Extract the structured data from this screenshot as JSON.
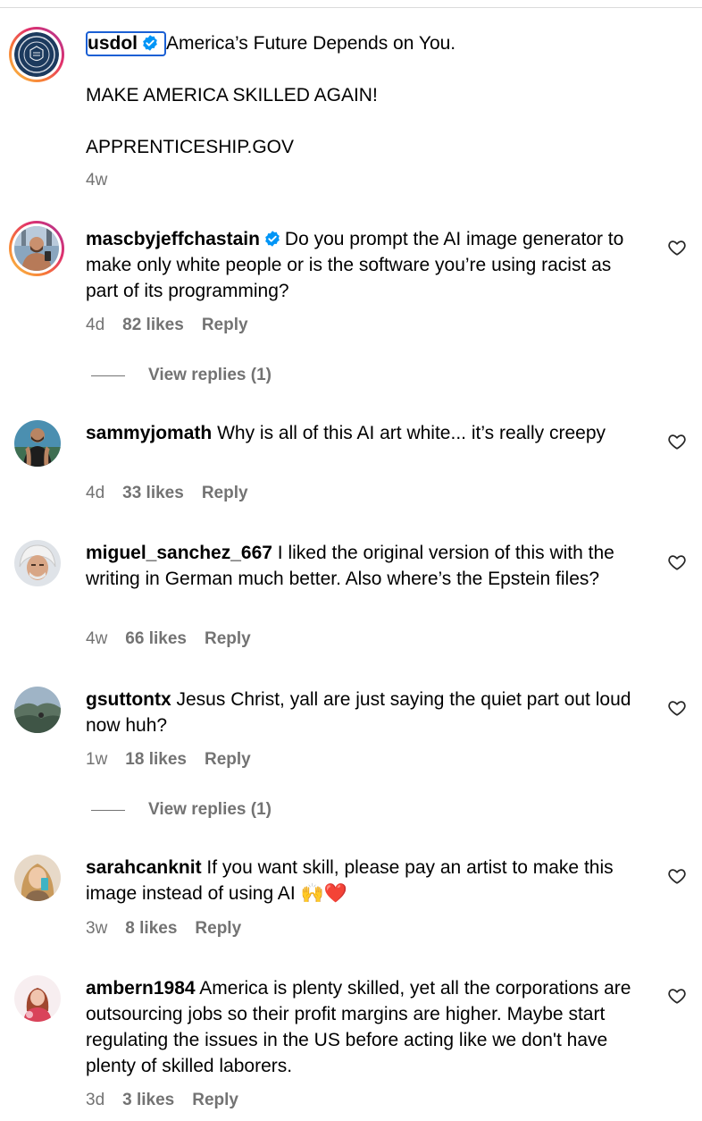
{
  "post": {
    "username": "usdol",
    "lines": [
      "America’s Future Depends on You.",
      "MAKE AMERICA SKILLED AGAIN!",
      "APPRENTICESHIP.GOV"
    ],
    "time": "4w"
  },
  "comments": [
    {
      "username": "mascbyjeffchastain",
      "verified": true,
      "text": "Do you prompt the AI image generator to make only white people or is the software you’re using racist as part of its programming?",
      "time": "4d",
      "likes": "82 likes",
      "reply": "Reply",
      "view_replies": "View replies (1)"
    },
    {
      "username": "sammyjomath",
      "text": "Why is all of this AI art white... it’s really creepy",
      "time": "4d",
      "likes": "33 likes",
      "reply": "Reply"
    },
    {
      "username": "miguel_sanchez_667",
      "text": "I liked the original version of this with the writing in German much better. Also where’s the Epstein files?",
      "time": "4w",
      "likes": "66 likes",
      "reply": "Reply"
    },
    {
      "username": "gsuttontx",
      "text": "Jesus Christ, yall are just saying the quiet part out loud now huh?",
      "time": "1w",
      "likes": "18 likes",
      "reply": "Reply",
      "view_replies": "View replies (1)"
    },
    {
      "username": "sarahcanknit",
      "text": "If you want skill, please pay an artist to make this image instead of using AI 🙌❤️",
      "time": "3w",
      "likes": "8 likes",
      "reply": "Reply"
    },
    {
      "username": "ambern1984",
      "text": "America is plenty skilled, yet all the corporations are outsourcing jobs so their profit margins are higher. Maybe start regulating the issues in the US before acting like we don't have plenty of skilled laborers.",
      "time": "3d",
      "likes": "3 likes",
      "reply": "Reply"
    }
  ],
  "icons": {
    "verified": "verified-badge-icon",
    "like": "heart-outline-icon"
  },
  "colors": {
    "verified": "#0095f6",
    "secondary_text": "#737373",
    "focus_outline": "#1a5fd4"
  }
}
